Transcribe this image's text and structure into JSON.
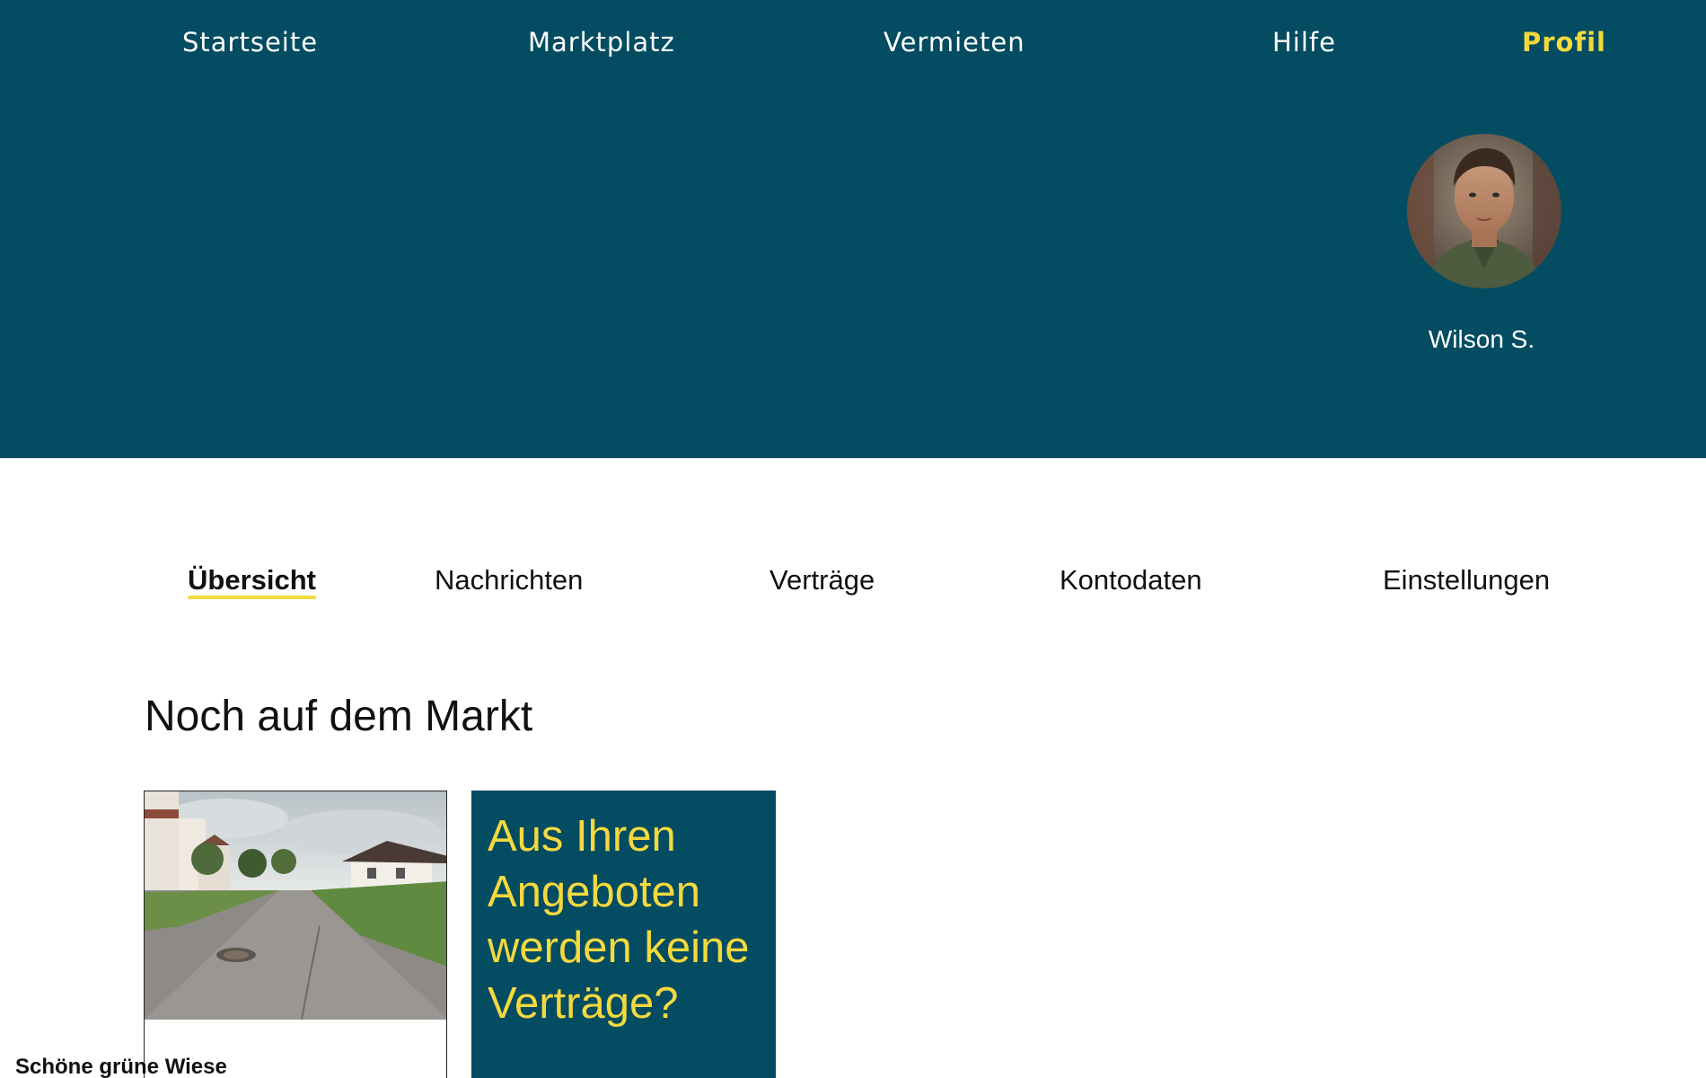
{
  "nav": {
    "items": [
      {
        "label": "Startseite"
      },
      {
        "label": "Marktplatz"
      },
      {
        "label": "Vermieten"
      },
      {
        "label": "Hilfe"
      },
      {
        "label": "Profil"
      }
    ],
    "active": "Profil"
  },
  "profile": {
    "name": "Wilson S."
  },
  "tabs": {
    "items": [
      {
        "label": "Übersicht"
      },
      {
        "label": "Nachrichten"
      },
      {
        "label": "Verträge"
      },
      {
        "label": "Kontodaten"
      },
      {
        "label": "Einstellungen"
      }
    ],
    "active": "Übersicht"
  },
  "section": {
    "title": "Noch auf dem Markt"
  },
  "listing": {
    "title": "Schöne grüne Wiese"
  },
  "promo": {
    "text": "Aus Ihren Angeboten werden keine Verträge?"
  },
  "colors": {
    "primary": "#034c61",
    "accent": "#f4d93e",
    "background": "#ffffff"
  }
}
